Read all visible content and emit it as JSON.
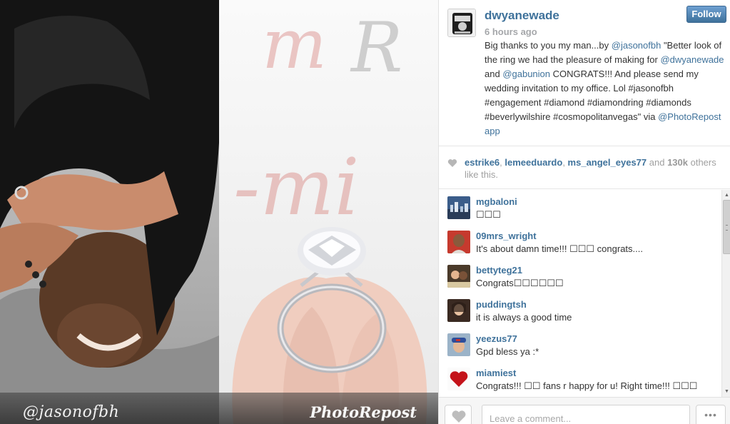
{
  "photo": {
    "watermark_left": "@jasonofbh",
    "watermark_right": "PhotoRepost"
  },
  "post": {
    "username": "dwyanewade",
    "time": "6 hours ago",
    "follow_label": "Follow",
    "caption": [
      {
        "t": "Big thanks to you my man...by ",
        "m": false
      },
      {
        "t": "@jasonofbh",
        "m": true
      },
      {
        "t": " \"Better look of the ring we had the pleasure of making for ",
        "m": false
      },
      {
        "t": "@dwyanewade",
        "m": true
      },
      {
        "t": " and ",
        "m": false
      },
      {
        "t": "@gabunion",
        "m": true
      },
      {
        "t": " CONGRATS!!! And please send my wedding invitation to my office. Lol #jasonofbh #engagement #diamond #diamondring #diamonds #beverlywilshire #cosmopolitanvegas\" via ",
        "m": false
      },
      {
        "t": "@PhotoRepost",
        "m": true
      },
      {
        "t": "  app",
        "m": true
      }
    ]
  },
  "likes": {
    "users": [
      "estrike6",
      "lemeeduardo",
      "ms_angel_eyes77"
    ],
    "sep": ", ",
    "and": " and ",
    "count": "130k",
    "tail": " others like this."
  },
  "comments": [
    {
      "user": "mgbaloni",
      "text": "☐☐☐",
      "avatar": "city"
    },
    {
      "user": "09mrs_wright",
      "text": "It's about damn time!!! ☐☐☐ congrats....",
      "avatar": "woman-red"
    },
    {
      "user": "bettyteg21",
      "text": "Congrats☐☐☐☐☐☐",
      "avatar": "couple"
    },
    {
      "user": "puddingtsh",
      "text": "it is always a good time",
      "avatar": "girl"
    },
    {
      "user": "yeezus77",
      "text": "Gpd bless ya :*",
      "avatar": "cap"
    },
    {
      "user": "miamiest",
      "text": "Congrats!!! ☐☐ fans r happy for u! Right time!!! ☐☐☐",
      "avatar": "heart"
    }
  ],
  "footer": {
    "comment_placeholder": "Leave a comment...",
    "more_label": "•••"
  },
  "colors": {
    "link": "#3f729b",
    "follow_button": "#3f729b",
    "muted": "#a5a7aa"
  },
  "icons": [
    "heart-icon",
    "like-heart-icon",
    "more-options-icon",
    "scroll-up-arrow-icon",
    "scroll-down-arrow-icon"
  ]
}
